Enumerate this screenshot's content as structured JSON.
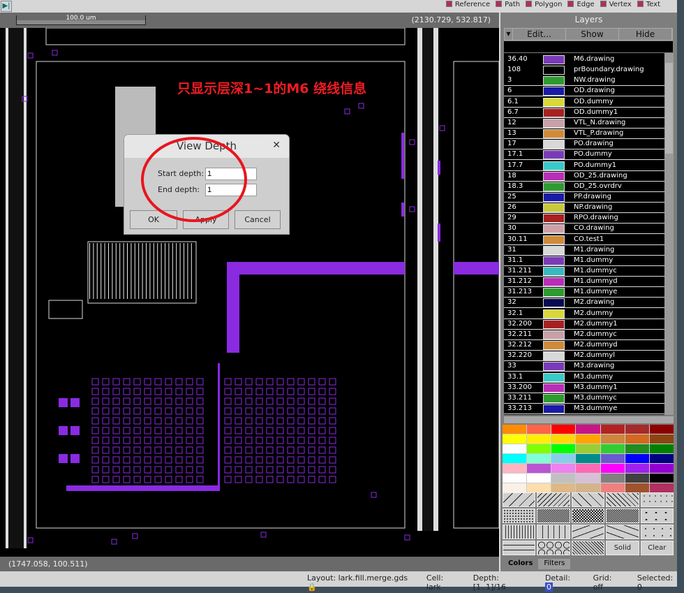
{
  "toolbar": {
    "filters": [
      "Reference",
      "Path",
      "Polygon",
      "Edge",
      "Vertex",
      "Text"
    ]
  },
  "canvas": {
    "scale_label": "100.0 um",
    "cursor_coord_top": "(2130.729, 532.817)",
    "cursor_coord_bottom": "(1747.058, 100.511)",
    "annotation": "只显示层深1~1的M6 绕线信息"
  },
  "dialog": {
    "title": "View Depth",
    "start_label": "Start depth:",
    "start_value": "1",
    "end_label": "End depth:",
    "end_value": "1",
    "ok": "OK",
    "apply": "Apply",
    "cancel": "Cancel"
  },
  "layers": {
    "title": "Layers",
    "edit": "Edit...",
    "show": "Show",
    "hide": "Hide",
    "items": [
      {
        "num": "36.40",
        "name": "M6.drawing",
        "color": "#7a3bb8"
      },
      {
        "num": "108",
        "name": "prBoundary.drawing",
        "color": "#000000"
      },
      {
        "num": "3",
        "name": "NW.drawing",
        "color": "#2e9b2e"
      },
      {
        "num": "6",
        "name": "OD.drawing",
        "color": "#1a1aa8"
      },
      {
        "num": "6.1",
        "name": "OD.dummy",
        "color": "#d8d83a"
      },
      {
        "num": "6.7",
        "name": "OD.dummy1",
        "color": "#a82020"
      },
      {
        "num": "12",
        "name": "VTL_N.drawing",
        "color": "#c8a0a8"
      },
      {
        "num": "13",
        "name": "VTL_P.drawing",
        "color": "#d08a3a"
      },
      {
        "num": "17",
        "name": "PO.drawing",
        "color": "#d8d8d8"
      },
      {
        "num": "17.1",
        "name": "PO.dummy",
        "color": "#7a3bb8"
      },
      {
        "num": "17.7",
        "name": "PO.dummy1",
        "color": "#3ac8c8"
      },
      {
        "num": "18",
        "name": "OD_25.drawing",
        "color": "#b82eb8"
      },
      {
        "num": "18.3",
        "name": "OD_25.ovrdrv",
        "color": "#2e9b2e"
      },
      {
        "num": "25",
        "name": "PP.drawing",
        "color": "#1a1aa8"
      },
      {
        "num": "26",
        "name": "NP.drawing",
        "color": "#c8c83a"
      },
      {
        "num": "29",
        "name": "RPO.drawing",
        "color": "#a82020"
      },
      {
        "num": "30",
        "name": "CO.drawing",
        "color": "#d0a0a8"
      },
      {
        "num": "30.11",
        "name": "CO.test1",
        "color": "#d08a3a"
      },
      {
        "num": "31",
        "name": "M1.drawing",
        "color": "#d8d8d8"
      },
      {
        "num": "31.1",
        "name": "M1.dummy",
        "color": "#7a3bb8"
      },
      {
        "num": "31.211",
        "name": "M1.dummyc",
        "color": "#3ab8c0"
      },
      {
        "num": "31.212",
        "name": "M1.dummyd",
        "color": "#b82eb8"
      },
      {
        "num": "31.213",
        "name": "M1.dummye",
        "color": "#2e9b2e"
      },
      {
        "num": "32",
        "name": "M2.drawing",
        "color": "#0a0a50"
      },
      {
        "num": "32.1",
        "name": "M2.dummy",
        "color": "#d8d83a"
      },
      {
        "num": "32.200",
        "name": "M2.dummy1",
        "color": "#a82020"
      },
      {
        "num": "32.211",
        "name": "M2.dummyc",
        "color": "#c8a0a8"
      },
      {
        "num": "32.212",
        "name": "M2.dummyd",
        "color": "#d08a3a"
      },
      {
        "num": "32.220",
        "name": "M2.dummyl",
        "color": "#d8d8d8"
      },
      {
        "num": "33",
        "name": "M3.drawing",
        "color": "#7a3bb8"
      },
      {
        "num": "33.1",
        "name": "M3.dummy",
        "color": "#3ac8c8"
      },
      {
        "num": "33.200",
        "name": "M3.dummy1",
        "color": "#b82eb8"
      },
      {
        "num": "33.211",
        "name": "M3.dummyc",
        "color": "#2e9b2e"
      },
      {
        "num": "33.213",
        "name": "M3.dummye",
        "color": "#1a1aa8"
      }
    ]
  },
  "palette": [
    "#ff8c00",
    "#ff6347",
    "#ff0000",
    "#c71585",
    "#b22222",
    "#a52a2a",
    "#8b0000",
    "#ffff00",
    "#ffee00",
    "#ffd700",
    "#ffa500",
    "#cd853f",
    "#d2691e",
    "#8b4513",
    "#f8ffff",
    "#7fff00",
    "#00ff00",
    "#9acd32",
    "#32cd32",
    "#228b22",
    "#008000",
    "#00ffff",
    "#7fffd4",
    "#87ceeb",
    "#008b8b",
    "#6a5acd",
    "#0000ff",
    "#000080",
    "#ffb6c1",
    "#ba55d3",
    "#ee82ee",
    "#ff69b4",
    "#ff00ff",
    "#a020f0",
    "#9400d3",
    "#ffffff",
    "#fefefe",
    "#c0c0c0",
    "#d8bfd8",
    "#808080",
    "#404040",
    "#000000",
    "#faf0e6",
    "#ffdead",
    "#deb887",
    "#d2b48c",
    "#f08080",
    "#a0522d",
    "#b03060"
  ],
  "patterns": {
    "solid": "Solid",
    "clear": "Clear"
  },
  "tabs": {
    "colors": "Colors",
    "filters": "Filters"
  },
  "status": {
    "layout_label": "Layout:",
    "layout": "lark.fill.merge.gds",
    "cell_label": "Cell:",
    "cell": "lark",
    "depth_label": "Depth:",
    "depth": "[1..1]/16",
    "detail_label": "Detail:",
    "detail": "0",
    "grid_label": "Grid:",
    "grid": "off",
    "selected_label": "Selected:",
    "selected": "0"
  }
}
